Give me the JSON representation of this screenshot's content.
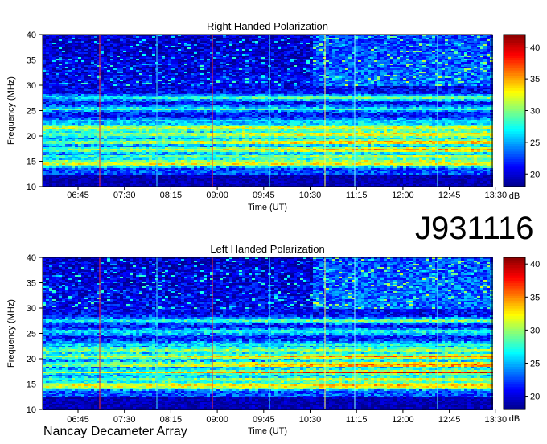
{
  "observation_id": "J931116",
  "credit": "Nancay Decameter Array",
  "colors": {
    "colormap": [
      "#00008f",
      "#0000ff",
      "#0080ff",
      "#00ffff",
      "#80ff80",
      "#ffff00",
      "#ff8000",
      "#ff0000",
      "#8f0000"
    ]
  },
  "chart_data": [
    {
      "type": "heatmap",
      "title": "Right Handed Polarization",
      "xlabel": "Time (UT)",
      "ylabel": "Frequency (MHz)",
      "x_ticks": [
        "06:45",
        "07:30",
        "08:15",
        "09:00",
        "09:45",
        "10:30",
        "11:15",
        "12:00",
        "12:45",
        "13:30"
      ],
      "y_ticks": [
        10,
        15,
        20,
        25,
        30,
        35,
        40
      ],
      "ylim": [
        10,
        40
      ],
      "colorbar": {
        "label": "dB",
        "ticks": [
          20,
          25,
          30,
          35,
          40
        ],
        "range": [
          18,
          42
        ]
      },
      "bands_mhz": [
        {
          "f": 14.7,
          "early": 40,
          "late": 41
        },
        {
          "f": 16.0,
          "early": 30,
          "late": 37
        },
        {
          "f": 17.5,
          "early": 32,
          "late": 40
        },
        {
          "f": 19.0,
          "early": 33,
          "late": 41
        },
        {
          "f": 20.5,
          "early": 34,
          "late": 40
        },
        {
          "f": 21.8,
          "early": 37,
          "late": 38
        },
        {
          "f": 23.0,
          "early": 27,
          "late": 28
        },
        {
          "f": 25.5,
          "early": 30,
          "late": 30
        },
        {
          "f": 27.7,
          "early": 28,
          "late": 33
        }
      ]
    },
    {
      "type": "heatmap",
      "title": "Left Handed Polarization",
      "xlabel": "Time (UT)",
      "ylabel": "Frequency (MHz)",
      "x_ticks": [
        "06:45",
        "07:30",
        "08:15",
        "09:00",
        "09:45",
        "10:30",
        "11:15",
        "12:00",
        "12:45",
        "13:30"
      ],
      "y_ticks": [
        10,
        15,
        20,
        25,
        30,
        35,
        40
      ],
      "ylim": [
        10,
        40
      ],
      "colorbar": {
        "label": "dB",
        "ticks": [
          20,
          25,
          30,
          35,
          40
        ],
        "range": [
          18,
          41
        ]
      },
      "bands_mhz": [
        {
          "f": 14.7,
          "early": 36,
          "late": 38
        },
        {
          "f": 16.0,
          "early": 30,
          "late": 36
        },
        {
          "f": 17.5,
          "early": 31,
          "late": 40
        },
        {
          "f": 19.0,
          "early": 32,
          "late": 41
        },
        {
          "f": 20.5,
          "early": 33,
          "late": 40
        },
        {
          "f": 21.8,
          "early": 35,
          "late": 37
        },
        {
          "f": 23.0,
          "early": 27,
          "late": 29
        },
        {
          "f": 25.5,
          "early": 29,
          "late": 30
        },
        {
          "f": 27.7,
          "early": 27,
          "late": 32
        }
      ]
    }
  ]
}
